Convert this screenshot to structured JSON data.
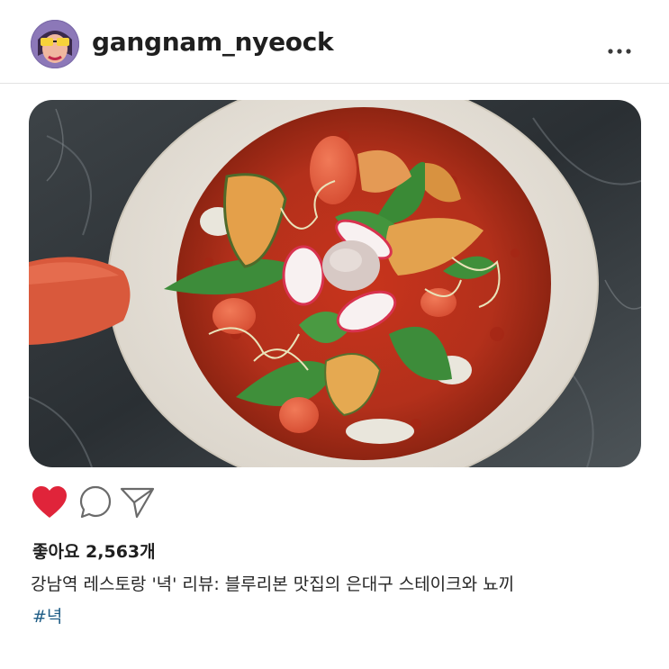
{
  "post": {
    "username": "gangnam_nyeock",
    "avatar_icon": "profile-avatar",
    "more_icon": "more-options-icon",
    "photo_alt": "food-photo",
    "likes_text": "좋아요 2,563개",
    "caption": "강남역 레스토랑 '녁' 리뷰: 블루리본 맛집의 은대구 스테이크와 뇨끼",
    "hashtag": "#녁"
  },
  "actions": {
    "like_icon": "heart-icon",
    "comment_icon": "comment-icon",
    "share_icon": "share-icon",
    "liked": true
  },
  "colors": {
    "heart": "#e0243a",
    "hashtag": "#1f5d86",
    "divider": "#e2e2e2"
  }
}
